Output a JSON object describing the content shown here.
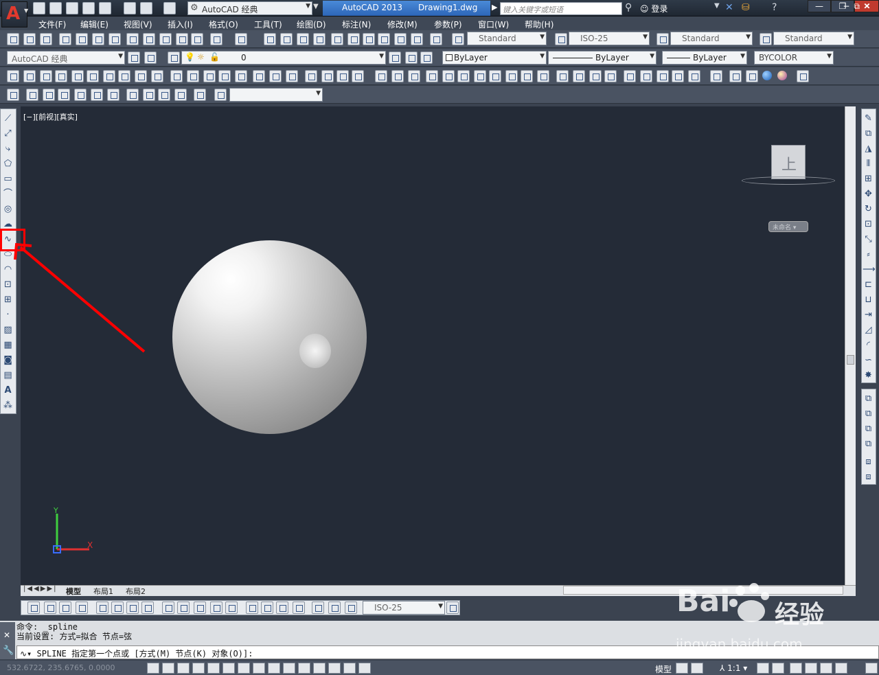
{
  "titlebar": {
    "workspace": "AutoCAD 经典",
    "app_version": "AutoCAD 2013",
    "file_name": "Drawing1.dwg",
    "search_placeholder": "键入关键字或短语",
    "login": "登录"
  },
  "menu": [
    "文件(F)",
    "编辑(E)",
    "视图(V)",
    "插入(I)",
    "格式(O)",
    "工具(T)",
    "绘图(D)",
    "标注(N)",
    "修改(M)",
    "参数(P)",
    "窗口(W)",
    "帮助(H)"
  ],
  "styles": {
    "text_style": "Standard",
    "dim_style": "ISO-25",
    "table_style": "Standard",
    "multileader_style": "Standard"
  },
  "layers": {
    "workspace_select": "AutoCAD 经典",
    "current_layer": "0",
    "color": "ByLayer",
    "linetype": "ByLayer",
    "lineweight": "ByLayer",
    "plotstyle": "BYCOLOR"
  },
  "viewport": {
    "label": "[−][前视][真实]",
    "viewcube_face": "上",
    "ucs_name": "未命名"
  },
  "layout_tabs": [
    "模型",
    "布局1",
    "布局2"
  ],
  "dim_toolbar_style": "ISO-25",
  "command": {
    "history_1": "命令: _spline",
    "history_2": "当前设置: 方式=拟合    节点=弦",
    "prompt": "SPLINE 指定第一个点或 [方式(M) 节点(K) 对象(O)]:"
  },
  "status": {
    "coords": "532.6722, 235.6765, 0.0000",
    "model": "模型",
    "annotation_scale": "1:1"
  },
  "watermark": {
    "brand": "Bai",
    "brand2": "经验",
    "url": "jingyan.baidu.com"
  },
  "colors": {
    "viewport_bg": "#242b37",
    "highlight": "#ff0000"
  }
}
